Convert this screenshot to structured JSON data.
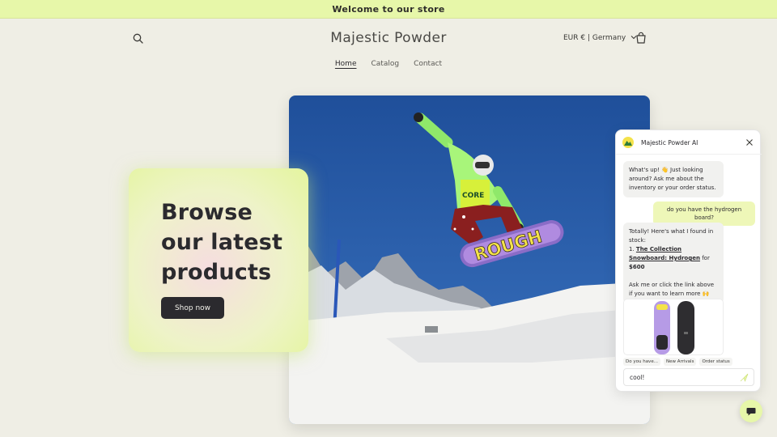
{
  "announcement": {
    "text": "Welcome to our store"
  },
  "header": {
    "logo": "Majestic Powder",
    "currency": "EUR € | Germany",
    "nav": [
      "Home",
      "Catalog",
      "Contact"
    ],
    "active_nav": "Home"
  },
  "hero": {
    "title": "Browse our latest products",
    "button": "Shop now",
    "board_text": "ROUGH"
  },
  "chat": {
    "title": "Majestic Powder AI",
    "messages": {
      "bot_greeting": "What's up! 👋 Just looking around? Ask me about the inventory or your order status.",
      "user_query": "do you have the hydrogen board?",
      "bot_intro": "Totally! Here's what I found in stock:",
      "item_number": "1.",
      "product_link": "The Collection Snowboard: Hydrogen",
      "for_text": "for",
      "price": "$600",
      "bot_outro": "Ask me or click the link above if you want to learn more 🙌"
    },
    "chips": [
      "Do you have...",
      "New Arrivals",
      "Order status"
    ],
    "input_value": "cool!"
  },
  "colors": {
    "accent": "#e7f7a9",
    "background": "#efeee5",
    "dark": "#2b2a2e"
  },
  "icons": {
    "search": "search-icon",
    "cart": "cart-icon",
    "chevron": "chevron-down-icon",
    "close": "close-icon",
    "send": "send-icon",
    "chat": "chat-bubble-icon"
  }
}
